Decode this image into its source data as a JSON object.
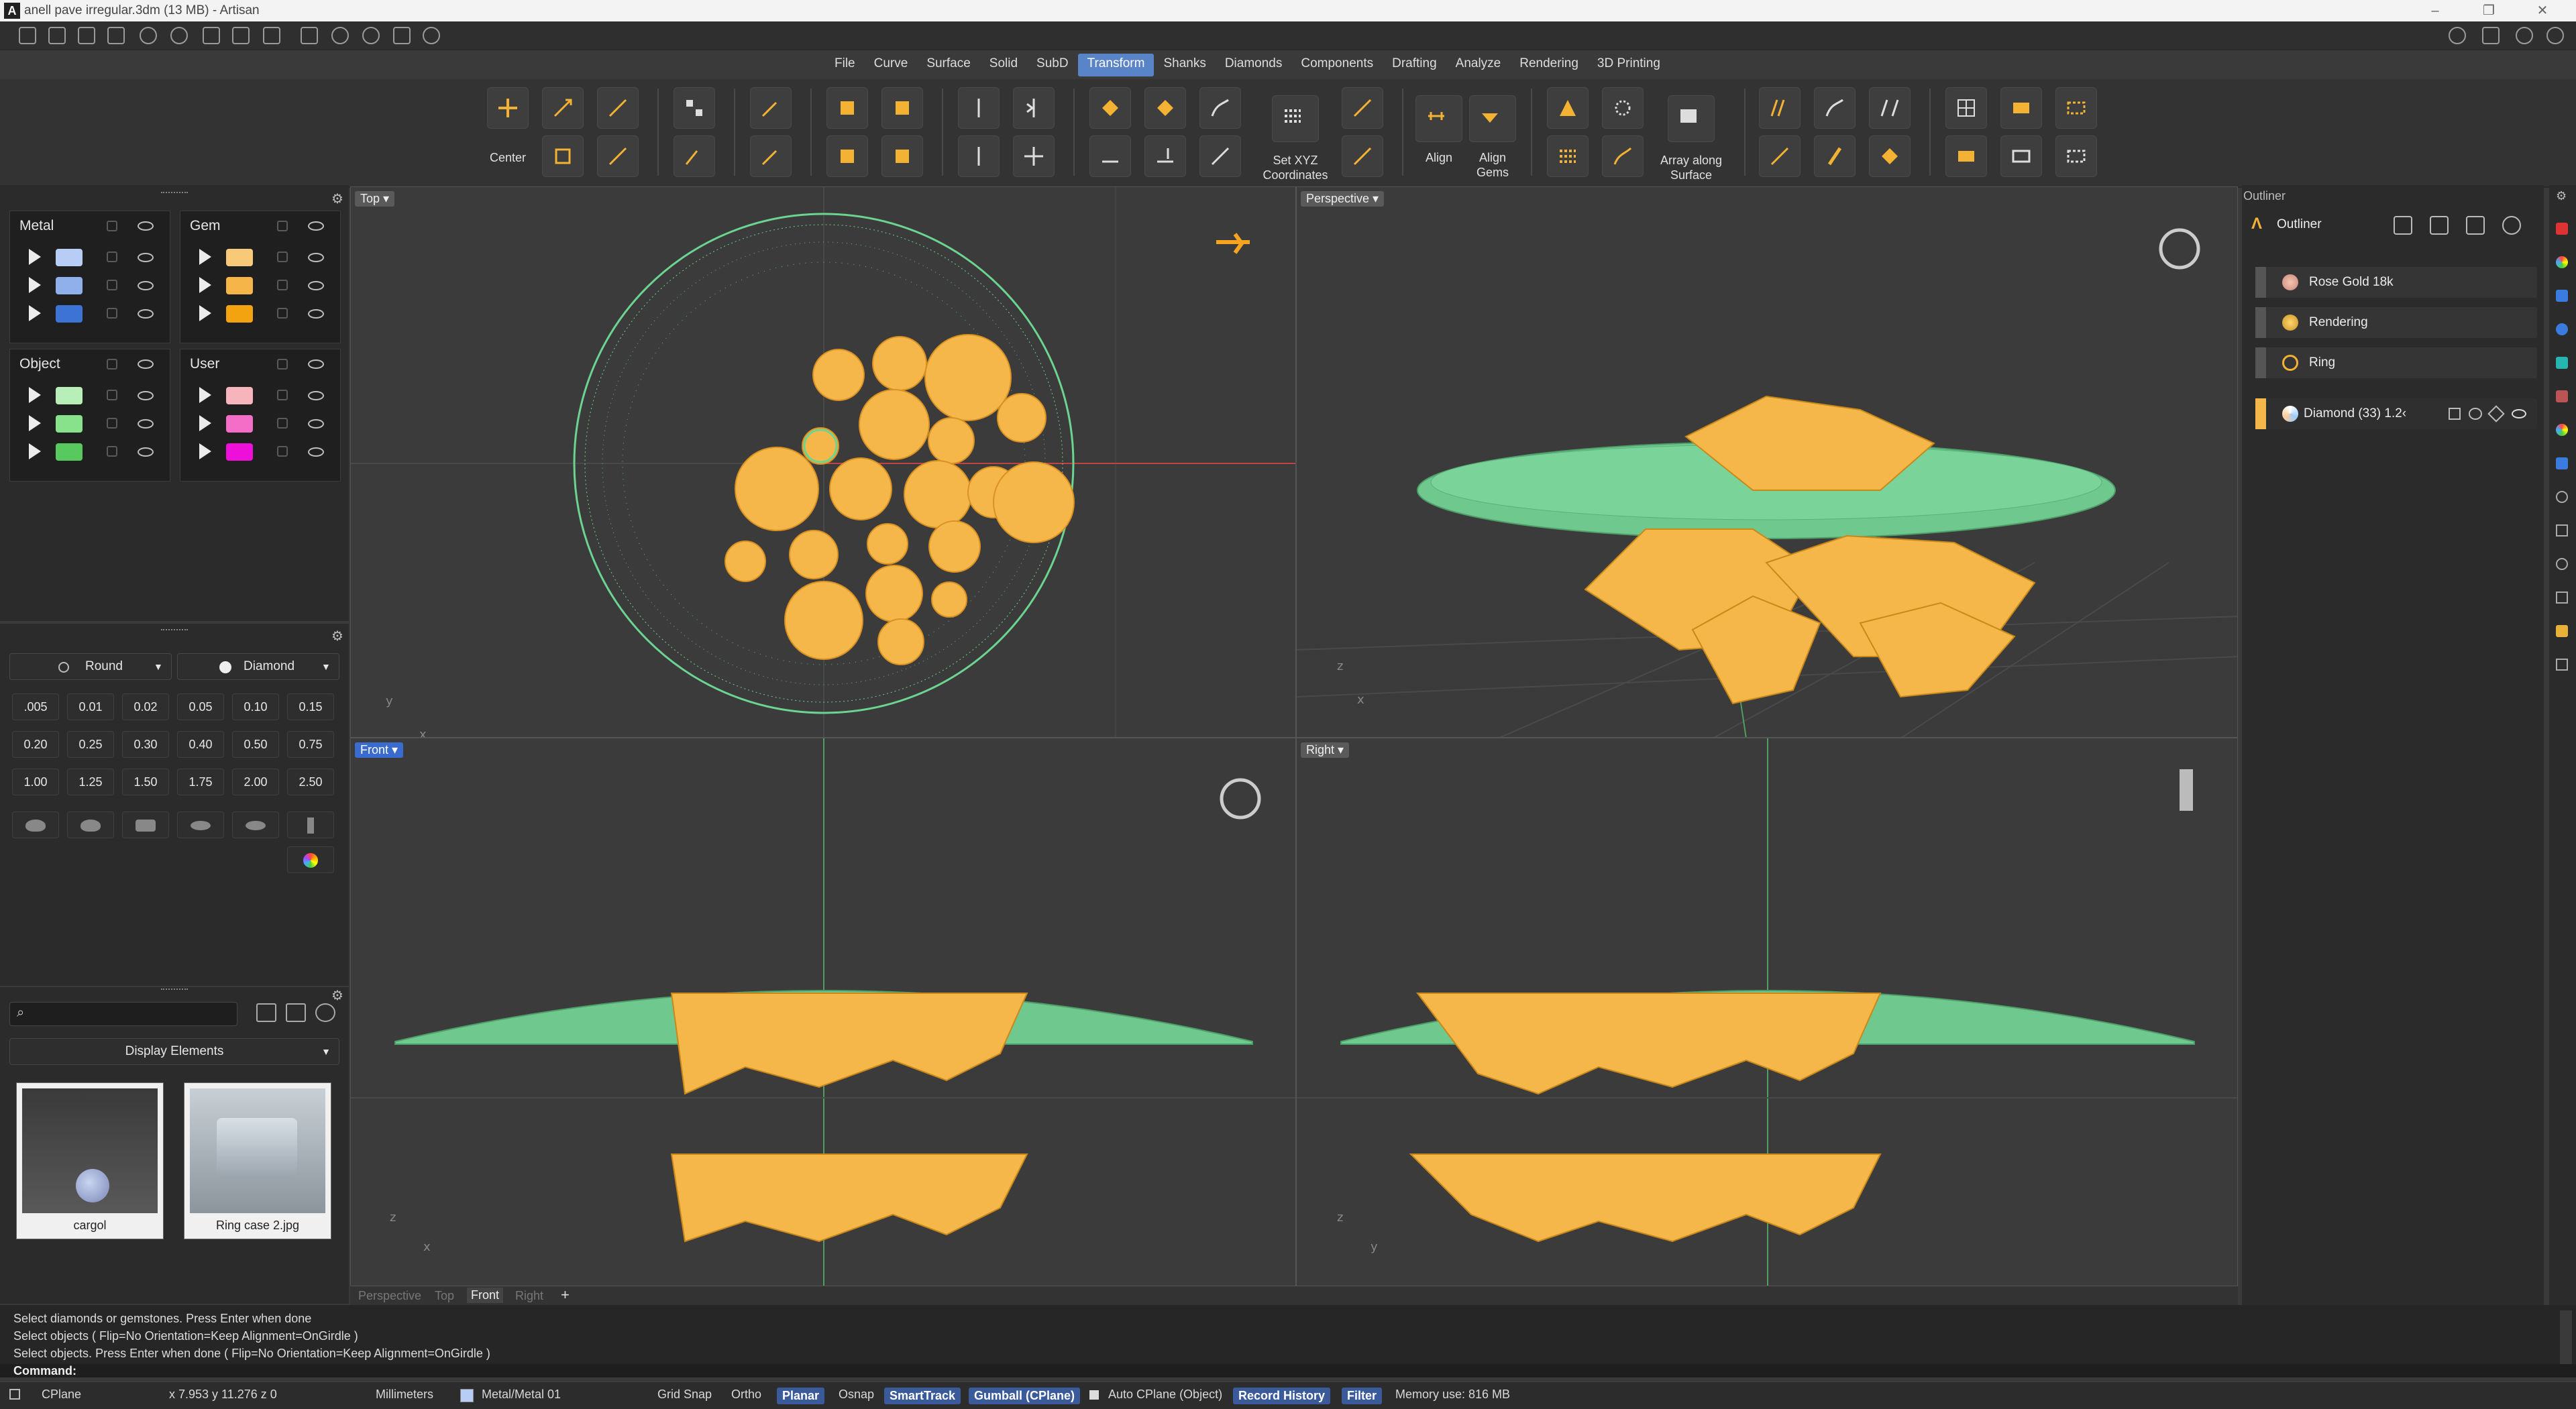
{
  "titlebar": {
    "title": "anell pave irregular.3dm (13 MB) - Artisan",
    "logo": "A"
  },
  "menu": [
    "File",
    "Curve",
    "Surface",
    "Solid",
    "SubD",
    "Transform",
    "Shanks",
    "Diamonds",
    "Components",
    "Drafting",
    "Analyze",
    "Rendering",
    "3D Printing"
  ],
  "menu_active": "Transform",
  "ribbon": {
    "center": "Center",
    "set_xyz": "Set XYZ\nCoordinates",
    "align": "Align",
    "align_gems": "Align\nGems",
    "array_surface": "Array along\nSurface"
  },
  "layers": {
    "metal": "Metal",
    "gem": "Gem",
    "object": "Object",
    "user": "User",
    "metal_colors": [
      "#b7cdf6",
      "#8fb0ea",
      "#3e73d6"
    ],
    "gem_colors": [
      "#f7c978",
      "#f6b548",
      "#f4a310"
    ],
    "object_colors": [
      "#b8efb9",
      "#88e28b",
      "#58c95e"
    ],
    "user_colors": [
      "#f6b4bd",
      "#f46ec7",
      "#ee10d8"
    ]
  },
  "gems": {
    "shape": "Round",
    "material": "Diamond",
    "sizes": [
      ".005",
      "0.01",
      "0.02",
      "0.05",
      "0.10",
      "0.15",
      "0.20",
      "0.25",
      "0.30",
      "0.40",
      "0.50",
      "0.75",
      "1.00",
      "1.25",
      "1.50",
      "1.75",
      "2.00",
      "2.50"
    ]
  },
  "library": {
    "display_elements": "Display Elements",
    "search_placeholder": "",
    "items": [
      "cargol",
      "Ring case 2.jpg"
    ]
  },
  "viewports": {
    "top": "Top",
    "perspective": "Perspective",
    "front": "Front",
    "right": "Right",
    "tabs": [
      "Perspective",
      "Top",
      "Front",
      "Right"
    ],
    "active_tab": "Front"
  },
  "outliner": {
    "title": "Outliner",
    "header": "Outliner",
    "items": [
      "Rose Gold 18k",
      "Rendering",
      "Ring"
    ],
    "diamond": "Diamond (33) 1.2‹"
  },
  "command": {
    "lines": [
      "Select diamonds or gemstones. Press Enter when done",
      "Select objects ( Flip=No  Orientation=Keep  Alignment=OnGirdle )",
      "Select objects. Press Enter when done ( Flip=No  Orientation=Keep  Alignment=OnGirdle )"
    ],
    "prompt": "Command:"
  },
  "status": {
    "cplane": "CPlane",
    "coords": "x 7.953   y 11.276   z 0",
    "units": "Millimeters",
    "layer": "Metal/Metal 01",
    "grid_snap": "Grid Snap",
    "ortho": "Ortho",
    "planar": "Planar",
    "osnap": "Osnap",
    "smarttrack": "SmartTrack",
    "gumball": "Gumball (CPlane)",
    "auto_cplane": "Auto CPlane (Object)",
    "record_history": "Record History",
    "filter": "Filter",
    "memory": "Memory use: 816 MB"
  }
}
